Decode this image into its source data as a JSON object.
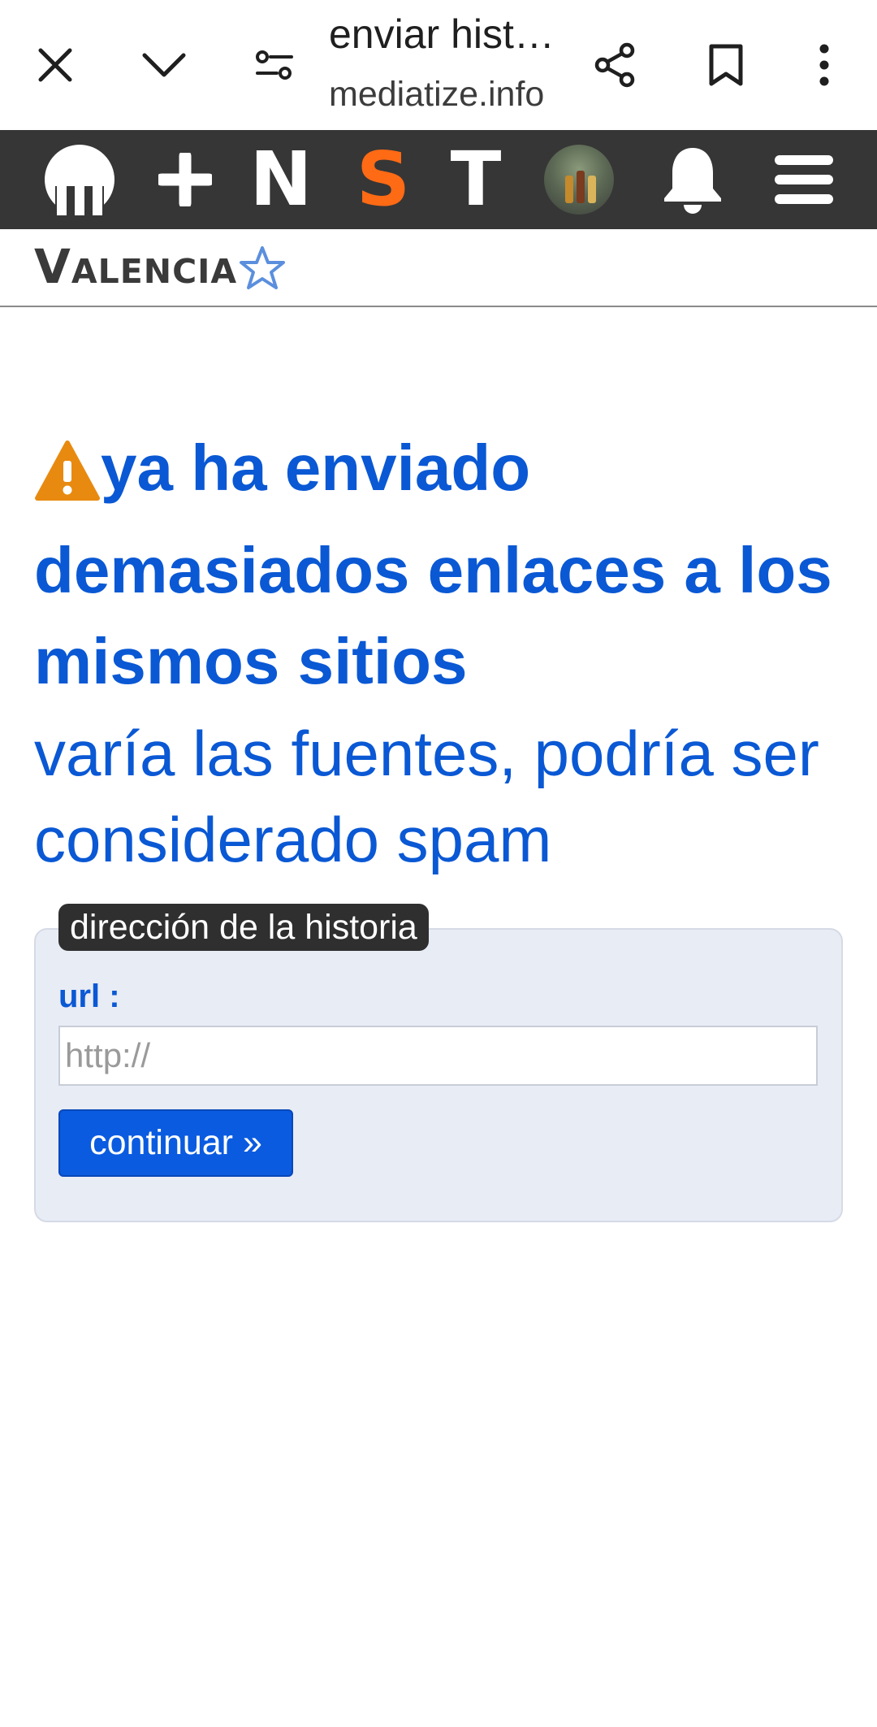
{
  "browser": {
    "title": "enviar historia",
    "domain": "mediatize.info",
    "icons": [
      "close-icon",
      "chevron-down-icon",
      "page-settings-icon",
      "share-icon",
      "bookmark-icon",
      "more-vert-icon"
    ]
  },
  "nav": {
    "letters": {
      "new": "N",
      "s": "S",
      "t": "T"
    },
    "icons": [
      "logo-icon",
      "plus-icon",
      "avatar",
      "bell-icon",
      "menu-icon"
    ],
    "accent_color": "#ff6a14",
    "bg_color": "#363636"
  },
  "sub_header": {
    "title": "Valencia",
    "star_icon": "star-outline-icon"
  },
  "warning": {
    "icon": "warning-icon",
    "title": "ya ha enviado demasiados enlaces a los mismos sitios",
    "subtitle": "varía las fuentes, podría ser considerado spam",
    "color": "#0a58d4"
  },
  "form": {
    "legend": "dirección de la historia",
    "url_label": "url :",
    "url_value": "",
    "url_placeholder": "http://",
    "submit_label": "continuar »",
    "button_color": "#0a5be0"
  }
}
